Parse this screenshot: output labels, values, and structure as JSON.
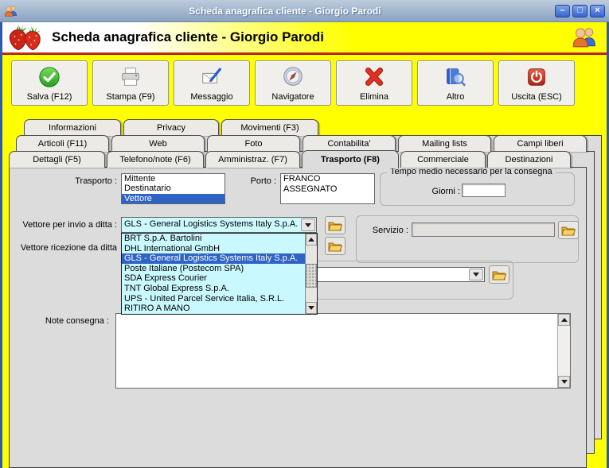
{
  "window": {
    "title": "Scheda anagrafica cliente - Giorgio Parodi",
    "controls": {
      "minimize": "–",
      "maximize": "□",
      "close": "×"
    }
  },
  "header": {
    "title": "Scheda anagrafica cliente - Giorgio Parodi"
  },
  "toolbar": {
    "buttons": [
      {
        "label": "Salva (F12)",
        "icon": "save-check-icon"
      },
      {
        "label": "Stampa (F9)",
        "icon": "printer-icon"
      },
      {
        "label": "Messaggio",
        "icon": "message-icon"
      },
      {
        "label": "Navigatore",
        "icon": "compass-icon"
      },
      {
        "label": "Elimina",
        "icon": "delete-x-icon"
      },
      {
        "label": "Altro",
        "icon": "book-magnifier-icon"
      },
      {
        "label": "Uscita (ESC)",
        "icon": "power-icon"
      }
    ]
  },
  "tabs": {
    "row1": [
      {
        "label": "Informazioni"
      },
      {
        "label": "Privacy"
      },
      {
        "label": "Movimenti (F3)"
      }
    ],
    "row2": [
      {
        "label": "Articoli (F11)"
      },
      {
        "label": "Web"
      },
      {
        "label": "Foto"
      },
      {
        "label": "Contabilita'"
      },
      {
        "label": "Mailing lists"
      },
      {
        "label": "Campi liberi"
      }
    ],
    "row3": [
      {
        "label": "Dettagli (F5)"
      },
      {
        "label": "Telefono/note (F6)"
      },
      {
        "label": "Amministraz. (F7)"
      },
      {
        "label": "Trasporto (F8)",
        "active": true
      },
      {
        "label": "Commerciale"
      },
      {
        "label": "Destinazioni"
      }
    ]
  },
  "form": {
    "trasporto_label": "Trasporto :",
    "trasporto_options": [
      "Mittente",
      "Destinatario",
      "Vettore"
    ],
    "trasporto_selected": "Vettore",
    "porto_label": "Porto :",
    "porto_lines": [
      "FRANCO",
      "ASSEGNATO"
    ],
    "tempo_group": {
      "legend": "Tempo medio necessario per la consegna",
      "giorni_label": "Giorni :",
      "giorni_value": ""
    },
    "vettore_invio_label": "Vettore per invio a ditta :",
    "vettore_invio_value": "GLS - General Logistics Systems Italy S.p.A.",
    "servizio_label": "Servizio :",
    "servizio_value": "",
    "vettore_ricezione_label": "Vettore ricezione da ditta",
    "ricezione_servizio_value": "",
    "note_label": "Note consegna :",
    "note_value": ""
  },
  "carrier_dropdown": {
    "items": [
      "BRT S.p.A. Bartolini",
      "DHL International GmbH",
      "GLS - General Logistics Systems Italy S.p.A.",
      "Poste Italiane (Postecom SPA)",
      "SDA Express Courier",
      "TNT Global Express S.p.A.",
      "UPS - United Parcel Service Italia, S.R.L.",
      "RITIRO A MANO"
    ],
    "selected_index": 2
  },
  "colors": {
    "selection_blue": "#2f63c4",
    "combo_cyan": "#cdfaff",
    "header_yellow": "#ffff00",
    "divider_red": "#c00000",
    "titlebar_blue": "#8aa3c2"
  }
}
